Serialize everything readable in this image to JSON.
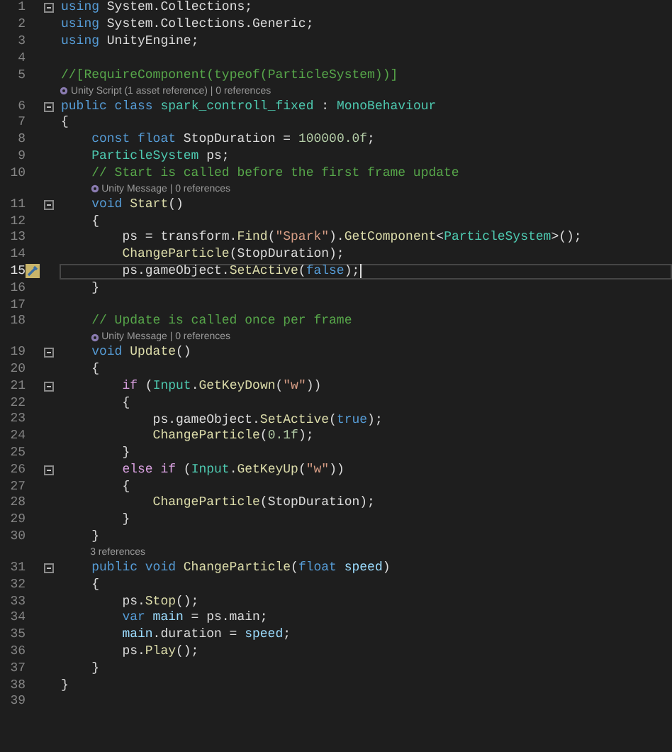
{
  "editor": {
    "lines": [
      {
        "kind": "code",
        "number": "1",
        "foldable": true,
        "current": false,
        "tokens": [
          {
            "kind": "keyword",
            "text": "using "
          },
          {
            "kind": "plain",
            "text": "System.Collections;"
          }
        ]
      },
      {
        "kind": "code",
        "number": "2",
        "foldable": false,
        "current": false,
        "tokens": [
          {
            "kind": "keyword",
            "text": "using "
          },
          {
            "kind": "plain",
            "text": "System.Collections.Generic;"
          }
        ]
      },
      {
        "kind": "code",
        "number": "3",
        "foldable": false,
        "current": false,
        "tokens": [
          {
            "kind": "keyword",
            "text": "using "
          },
          {
            "kind": "plain",
            "text": "UnityEngine;"
          }
        ]
      },
      {
        "kind": "code",
        "number": "4",
        "foldable": false,
        "current": false
      },
      {
        "kind": "code",
        "number": "5",
        "foldable": false,
        "current": false,
        "tokens": [
          {
            "kind": "comment",
            "text": "//[RequireComponent(typeof(ParticleSystem))]"
          }
        ]
      },
      {
        "kind": "lens",
        "icon": true,
        "text": "Unity Script (1 asset reference) | 0 references"
      },
      {
        "kind": "code",
        "number": "6",
        "foldable": true,
        "current": false,
        "tokens": [
          {
            "kind": "keyword",
            "text": "public class "
          },
          {
            "kind": "type",
            "text": "spark_controll_fixed"
          },
          {
            "kind": "plain",
            "text": " : "
          },
          {
            "kind": "type",
            "text": "MonoBehaviour"
          }
        ]
      },
      {
        "kind": "code",
        "number": "7",
        "foldable": false,
        "current": false,
        "tokens": [
          {
            "kind": "plain",
            "text": "{"
          }
        ]
      },
      {
        "kind": "code",
        "number": "8",
        "foldable": false,
        "current": false,
        "tokens": [
          {
            "kind": "keyword",
            "text": "const float"
          },
          {
            "kind": "plain",
            "text": " StopDuration = "
          },
          {
            "kind": "number",
            "text": "100000.0f"
          },
          {
            "kind": "plain",
            "text": ";"
          }
        ]
      },
      {
        "kind": "code",
        "number": "9",
        "foldable": false,
        "current": false,
        "tokens": [
          {
            "kind": "type",
            "text": "ParticleSystem"
          },
          {
            "kind": "plain",
            "text": " ps;"
          }
        ]
      },
      {
        "kind": "code",
        "number": "10",
        "foldable": false,
        "current": false,
        "tokens": [
          {
            "kind": "comment",
            "text": "// Start is called before the first frame update"
          }
        ]
      },
      {
        "kind": "lens",
        "icon": true,
        "text": "Unity Message | 0 references"
      },
      {
        "kind": "code",
        "number": "11",
        "foldable": true,
        "current": false,
        "tokens": [
          {
            "kind": "keyword",
            "text": "void "
          },
          {
            "kind": "method",
            "text": "Start"
          },
          {
            "kind": "plain",
            "text": "()"
          }
        ]
      },
      {
        "kind": "code",
        "number": "12",
        "foldable": false,
        "current": false,
        "tokens": [
          {
            "kind": "plain",
            "text": "{"
          }
        ]
      },
      {
        "kind": "code",
        "number": "13",
        "foldable": false,
        "current": false,
        "tokens": [
          {
            "kind": "plain",
            "text": "ps = transform."
          },
          {
            "kind": "method",
            "text": "Find"
          },
          {
            "kind": "plain",
            "text": "("
          },
          {
            "kind": "string",
            "text": "\"Spark\""
          },
          {
            "kind": "plain",
            "text": ")."
          },
          {
            "kind": "method",
            "text": "GetComponent"
          },
          {
            "kind": "plain",
            "text": "<"
          },
          {
            "kind": "type",
            "text": "ParticleSystem"
          },
          {
            "kind": "plain",
            "text": ">();"
          }
        ]
      },
      {
        "kind": "code",
        "number": "14",
        "foldable": false,
        "current": false,
        "tokens": [
          {
            "kind": "method",
            "text": "ChangeParticle"
          },
          {
            "kind": "plain",
            "text": "(StopDuration);"
          }
        ]
      },
      {
        "kind": "code",
        "number": "15",
        "foldable": false,
        "current": true,
        "tokens": [
          {
            "kind": "plain",
            "text": "ps.gameObject."
          },
          {
            "kind": "method",
            "text": "SetActive"
          },
          {
            "kind": "plain",
            "text": "("
          },
          {
            "kind": "keyword",
            "text": "false"
          },
          {
            "kind": "plain",
            "text": ");"
          }
        ]
      },
      {
        "kind": "code",
        "number": "16",
        "foldable": false,
        "current": false,
        "tokens": [
          {
            "kind": "plain",
            "text": "}"
          }
        ]
      },
      {
        "kind": "code",
        "number": "17",
        "foldable": false,
        "current": false
      },
      {
        "kind": "code",
        "number": "18",
        "foldable": false,
        "current": false,
        "tokens": [
          {
            "kind": "comment",
            "text": "// Update is called once per frame"
          }
        ]
      },
      {
        "kind": "lens",
        "icon": true,
        "text": "Unity Message | 0 references"
      },
      {
        "kind": "code",
        "number": "19",
        "foldable": true,
        "current": false,
        "tokens": [
          {
            "kind": "keyword",
            "text": "void "
          },
          {
            "kind": "method",
            "text": "Update"
          },
          {
            "kind": "plain",
            "text": "()"
          }
        ]
      },
      {
        "kind": "code",
        "number": "20",
        "foldable": false,
        "current": false,
        "tokens": [
          {
            "kind": "plain",
            "text": "{"
          }
        ]
      },
      {
        "kind": "code",
        "number": "21",
        "foldable": true,
        "current": false,
        "tokens": [
          {
            "kind": "control",
            "text": "if"
          },
          {
            "kind": "plain",
            "text": " ("
          },
          {
            "kind": "type",
            "text": "Input"
          },
          {
            "kind": "plain",
            "text": "."
          },
          {
            "kind": "method",
            "text": "GetKeyDown"
          },
          {
            "kind": "plain",
            "text": "("
          },
          {
            "kind": "string",
            "text": "\"w\""
          },
          {
            "kind": "plain",
            "text": "))"
          }
        ]
      },
      {
        "kind": "code",
        "number": "22",
        "foldable": false,
        "current": false,
        "tokens": [
          {
            "kind": "plain",
            "text": "{"
          }
        ]
      },
      {
        "kind": "code",
        "number": "23",
        "foldable": false,
        "current": false,
        "tokens": [
          {
            "kind": "plain",
            "text": "ps.gameObject."
          },
          {
            "kind": "method",
            "text": "SetActive"
          },
          {
            "kind": "plain",
            "text": "("
          },
          {
            "kind": "keyword",
            "text": "true"
          },
          {
            "kind": "plain",
            "text": ");"
          }
        ]
      },
      {
        "kind": "code",
        "number": "24",
        "foldable": false,
        "current": false,
        "tokens": [
          {
            "kind": "method",
            "text": "ChangeParticle"
          },
          {
            "kind": "plain",
            "text": "("
          },
          {
            "kind": "number",
            "text": "0.1f"
          },
          {
            "kind": "plain",
            "text": ");"
          }
        ]
      },
      {
        "kind": "code",
        "number": "25",
        "foldable": false,
        "current": false,
        "tokens": [
          {
            "kind": "plain",
            "text": "}"
          }
        ]
      },
      {
        "kind": "code",
        "number": "26",
        "foldable": true,
        "current": false,
        "tokens": [
          {
            "kind": "control",
            "text": "else if"
          },
          {
            "kind": "plain",
            "text": " ("
          },
          {
            "kind": "type",
            "text": "Input"
          },
          {
            "kind": "plain",
            "text": "."
          },
          {
            "kind": "method",
            "text": "GetKeyUp"
          },
          {
            "kind": "plain",
            "text": "("
          },
          {
            "kind": "string",
            "text": "\"w\""
          },
          {
            "kind": "plain",
            "text": "))"
          }
        ]
      },
      {
        "kind": "code",
        "number": "27",
        "foldable": false,
        "current": false,
        "tokens": [
          {
            "kind": "plain",
            "text": "{"
          }
        ]
      },
      {
        "kind": "code",
        "number": "28",
        "foldable": false,
        "current": false,
        "tokens": [
          {
            "kind": "method",
            "text": "ChangeParticle"
          },
          {
            "kind": "plain",
            "text": "(StopDuration);"
          }
        ]
      },
      {
        "kind": "code",
        "number": "29",
        "foldable": false,
        "current": false,
        "tokens": [
          {
            "kind": "plain",
            "text": "}"
          }
        ]
      },
      {
        "kind": "code",
        "number": "30",
        "foldable": false,
        "current": false,
        "tokens": [
          {
            "kind": "plain",
            "text": "}"
          }
        ]
      },
      {
        "kind": "lens",
        "icon": false,
        "text": "3 references"
      },
      {
        "kind": "code",
        "number": "31",
        "foldable": true,
        "current": false,
        "tokens": [
          {
            "kind": "keyword",
            "text": "public void "
          },
          {
            "kind": "method",
            "text": "ChangeParticle"
          },
          {
            "kind": "plain",
            "text": "("
          },
          {
            "kind": "keyword",
            "text": "float "
          },
          {
            "kind": "variable",
            "text": "speed"
          },
          {
            "kind": "plain",
            "text": ")"
          }
        ]
      },
      {
        "kind": "code",
        "number": "32",
        "foldable": false,
        "current": false,
        "tokens": [
          {
            "kind": "plain",
            "text": "{"
          }
        ]
      },
      {
        "kind": "code",
        "number": "33",
        "foldable": false,
        "current": false,
        "tokens": [
          {
            "kind": "plain",
            "text": "ps."
          },
          {
            "kind": "method",
            "text": "Stop"
          },
          {
            "kind": "plain",
            "text": "();"
          }
        ]
      },
      {
        "kind": "code",
        "number": "34",
        "foldable": false,
        "current": false,
        "tokens": [
          {
            "kind": "keyword",
            "text": "var "
          },
          {
            "kind": "variable",
            "text": "main"
          },
          {
            "kind": "plain",
            "text": " = ps.main;"
          }
        ]
      },
      {
        "kind": "code",
        "number": "35",
        "foldable": false,
        "current": false,
        "tokens": [
          {
            "kind": "variable",
            "text": "main"
          },
          {
            "kind": "plain",
            "text": ".duration = "
          },
          {
            "kind": "variable",
            "text": "speed"
          },
          {
            "kind": "plain",
            "text": ";"
          }
        ]
      },
      {
        "kind": "code",
        "number": "36",
        "foldable": false,
        "current": false,
        "tokens": [
          {
            "kind": "plain",
            "text": "ps."
          },
          {
            "kind": "method",
            "text": "Play"
          },
          {
            "kind": "plain",
            "text": "();"
          }
        ]
      },
      {
        "kind": "code",
        "number": "37",
        "foldable": false,
        "current": false,
        "tokens": [
          {
            "kind": "plain",
            "text": "}"
          }
        ]
      },
      {
        "kind": "code",
        "number": "38",
        "foldable": false,
        "current": false,
        "tokens": [
          {
            "kind": "plain",
            "text": "}"
          }
        ]
      },
      {
        "kind": "code",
        "number": "39",
        "foldable": false,
        "current": false
      }
    ]
  }
}
